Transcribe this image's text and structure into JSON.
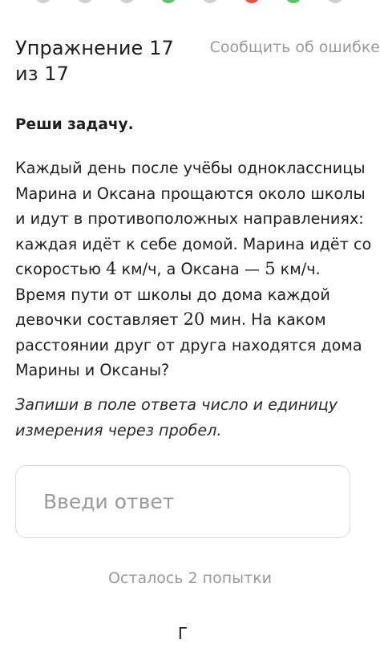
{
  "progress": {
    "dot_colors": [
      "#cfcfcf",
      "#cfcfcf",
      "#cfcfcf",
      "#5fbf6a",
      "#cfcfcf",
      "#e0574f",
      "#5fbf6a",
      "#cfcfcf"
    ]
  },
  "header": {
    "title_line1": "Упражнение 17",
    "title_line2": "из 17",
    "report_label": "Сообщить об ошибке"
  },
  "task": {
    "label": "Реши задачу.",
    "text_part1": "Каждый день после учёбы одноклассницы Марина и Оксана прощаются около школы и идут в противоположных направлениях: каждая идёт к себе домой. Марина идёт со скоростью ",
    "speed_marina": "4",
    "text_part2": " км/ч, а Оксана — ",
    "speed_oksana": "5",
    "text_part3": " км/ч. Время пути от школы до дома каждой девочки составляет ",
    "time_minutes": "20",
    "text_part4": " мин. На каком расстоянии друг от друга находятся дома Марины и Оксаны?",
    "instruction": "Запиши в поле ответа число и единицу измерения через пробел."
  },
  "answer": {
    "placeholder": "Введи ответ",
    "value": ""
  },
  "attempts_text": "Осталось 2 попытки",
  "submit_label": "Г"
}
